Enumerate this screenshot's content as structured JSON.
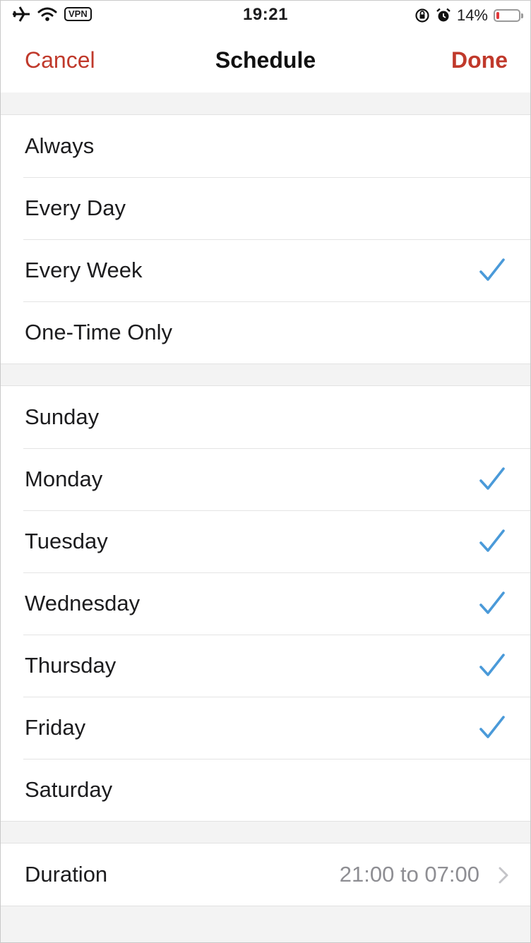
{
  "status_bar": {
    "time": "19:21",
    "vpn": "VPN",
    "battery_percent": "14%",
    "battery_level": 0.14,
    "icons": [
      "airplane-icon",
      "wifi-icon",
      "orientation-lock-icon",
      "alarm-icon",
      "battery-icon"
    ]
  },
  "nav": {
    "cancel_label": "Cancel",
    "title": "Schedule",
    "done_label": "Done"
  },
  "frequency": {
    "options": [
      {
        "label": "Always",
        "checked": false
      },
      {
        "label": "Every Day",
        "checked": false
      },
      {
        "label": "Every Week",
        "checked": true
      },
      {
        "label": "One-Time Only",
        "checked": false
      }
    ]
  },
  "days": {
    "items": [
      {
        "label": "Sunday",
        "checked": false
      },
      {
        "label": "Monday",
        "checked": true
      },
      {
        "label": "Tuesday",
        "checked": true
      },
      {
        "label": "Wednesday",
        "checked": true
      },
      {
        "label": "Thursday",
        "checked": true
      },
      {
        "label": "Friday",
        "checked": true
      },
      {
        "label": "Saturday",
        "checked": false
      }
    ]
  },
  "duration": {
    "label": "Duration",
    "value": "21:00 to 07:00"
  },
  "colors": {
    "accent_red": "#c0392b",
    "check_blue": "#4a9ad9",
    "battery_low": "#e0383a"
  }
}
